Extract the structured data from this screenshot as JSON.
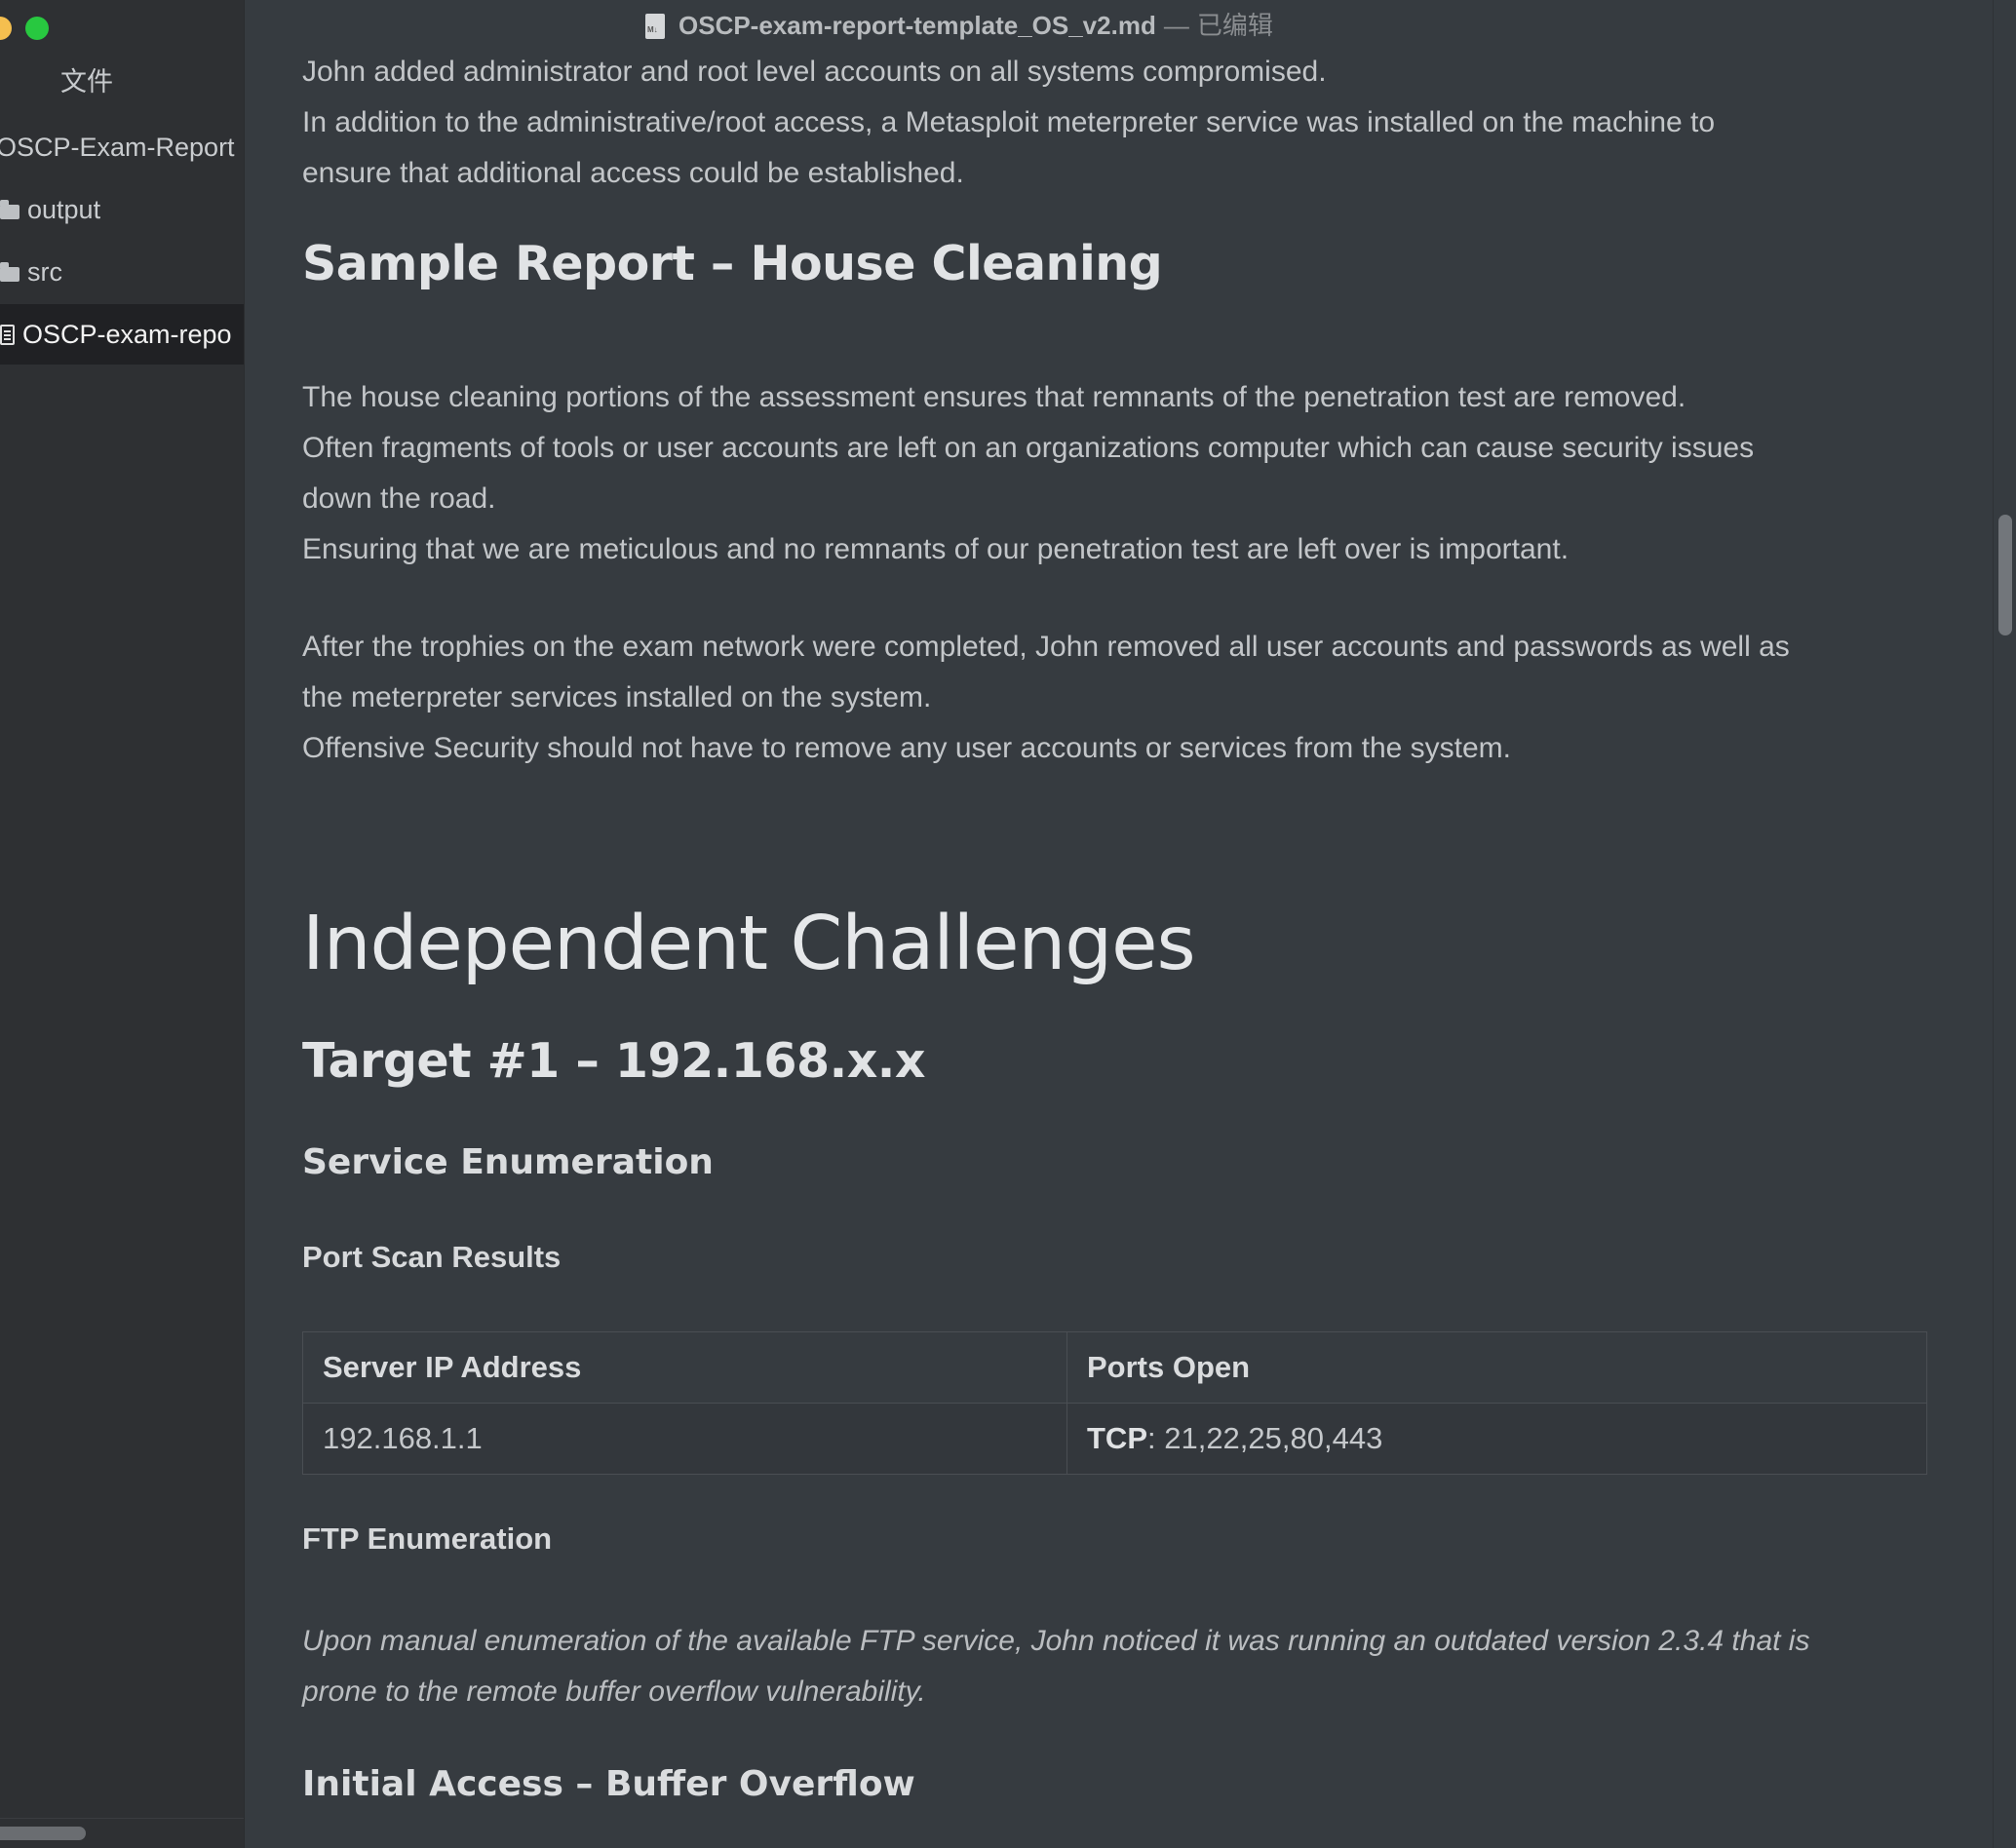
{
  "window": {
    "title_file": "OSCP-exam-report-template_OS_v2.md",
    "title_separator": "—",
    "title_status": "已编辑"
  },
  "sidebar": {
    "title": "文件",
    "root_folder": "OSCP-Exam-Report",
    "items": [
      {
        "label": "output",
        "icon": "folder-icon"
      },
      {
        "label": "src",
        "icon": "folder-icon"
      },
      {
        "label": "OSCP-exam-repo",
        "icon": "document-icon",
        "selected": true
      }
    ]
  },
  "doc": {
    "p_intro_1": "John added administrator and root level accounts on all systems compromised.",
    "p_intro_2": "In addition to the administrative/root access, a Metasploit meterpreter service was installed on the machine to",
    "p_intro_3": "ensure that additional access could be established.",
    "h_house_cleaning": "Sample Report – House Cleaning",
    "p_hc_1": "The house cleaning portions of the assessment ensures that remnants of the penetration test are removed.",
    "p_hc_2": "Often fragments of tools or user accounts are left on an organizations computer which can cause security issues",
    "p_hc_3": "down the road.",
    "p_hc_4": "Ensuring that we are meticulous and no remnants of our penetration test are left over is important.",
    "p_hc_5": "After the trophies on the exam network were completed, John removed all user accounts and passwords as well as",
    "p_hc_6": "the meterpreter services installed on the system.",
    "p_hc_7": "Offensive Security should not have to remove any user accounts or services from the system.",
    "h_independent": "Independent Challenges",
    "h_target": "Target #1 – 192.168.x.x",
    "h_service_enum": "Service Enumeration",
    "h_port_scan": "Port Scan Results",
    "table": {
      "headers": [
        "Server IP Address",
        "Ports Open"
      ],
      "rows": [
        {
          "ip": "192.168.1.1",
          "proto": "TCP",
          "ports": ": 21,22,25,80,443"
        }
      ]
    },
    "h_ftp_enum": "FTP Enumeration",
    "p_ftp_1": "Upon manual enumeration of the available FTP service, John noticed it was running an outdated version 2.3.4 that is",
    "p_ftp_2": "prone to the remote buffer overflow vulnerability.",
    "h_initial_access": "Initial Access – Buffer Overflow"
  }
}
